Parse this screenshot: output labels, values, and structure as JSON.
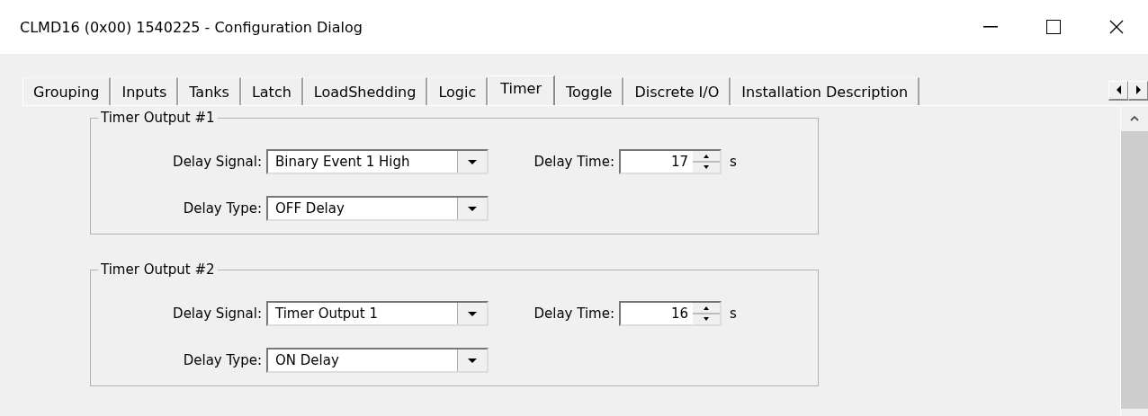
{
  "window": {
    "title": "CLMD16 (0x00) 1540225 - Configuration Dialog"
  },
  "tabs": [
    {
      "label": "Grouping",
      "selected": false
    },
    {
      "label": "Inputs",
      "selected": false
    },
    {
      "label": "Tanks",
      "selected": false
    },
    {
      "label": "Latch",
      "selected": false
    },
    {
      "label": "LoadShedding",
      "selected": false
    },
    {
      "label": "Logic",
      "selected": false
    },
    {
      "label": "Timer",
      "selected": true
    },
    {
      "label": "Toggle",
      "selected": false
    },
    {
      "label": "Discrete I/O",
      "selected": false
    },
    {
      "label": "Installation Description",
      "selected": false
    }
  ],
  "groups": [
    {
      "title": "Timer Output #1",
      "signal_label": "Delay Signal:",
      "signal": "Binary Event 1 High",
      "time_label": "Delay Time:",
      "time": "17",
      "unit": "s",
      "type_label": "Delay Type:",
      "type": "OFF Delay"
    },
    {
      "title": "Timer Output #2",
      "signal_label": "Delay Signal:",
      "signal": "Timer Output 1",
      "time_label": "Delay Time:",
      "time": "16",
      "unit": "s",
      "type_label": "Delay Type:",
      "type": "ON Delay"
    }
  ]
}
